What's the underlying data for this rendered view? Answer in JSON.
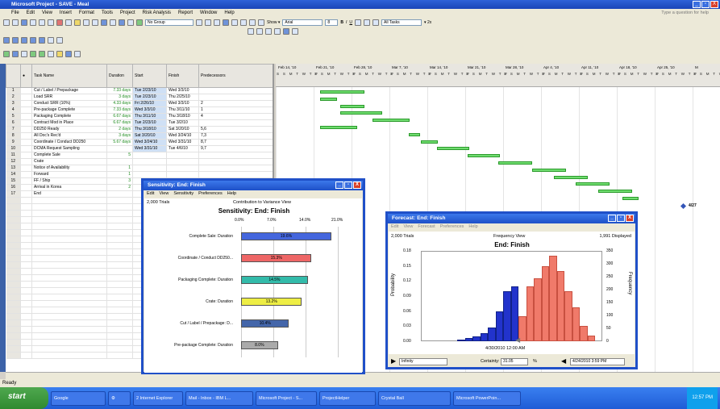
{
  "app": {
    "title": "Microsoft Project - SAVE - Meal",
    "minimize": "_",
    "restore": "▫",
    "close": "X"
  },
  "menu": {
    "items": [
      "File",
      "Edit",
      "View",
      "Insert",
      "Format",
      "Tools",
      "Project",
      "Risk Analysis",
      "Report",
      "Window",
      "Help"
    ],
    "ask": "Type a question for help"
  },
  "toolbar": {
    "group": "No Group",
    "show": "Show ▾",
    "font": "Arial",
    "size": "8",
    "bold": "B",
    "italic": "I",
    "underline": "U",
    "filter": "All Tasks",
    "zoom": "▾ 2x"
  },
  "grid": {
    "headers": {
      "id": "",
      "indicator": "Indicators",
      "name": "Task Name",
      "duration": "Duration",
      "start": "Start",
      "finish": "Finish",
      "pred": "Predecessors"
    },
    "rows": [
      {
        "id": "1",
        "name": "Cut / Label / Prepackage",
        "duration": "7.33 days",
        "start": "Tue 2/23/10",
        "finish": "Wed 3/3/10",
        "pred": ""
      },
      {
        "id": "2",
        "name": "Load SRR",
        "duration": "3 days",
        "start": "Tue 2/23/10",
        "finish": "Thu 2/25/10",
        "pred": ""
      },
      {
        "id": "3",
        "name": "Conduct SRR (10%)",
        "duration": "4.33 days",
        "start": "Fri 2/26/10",
        "finish": "Wed 3/3/10",
        "pred": "2"
      },
      {
        "id": "4",
        "name": "Pre-package Complete",
        "duration": "7.33 days",
        "start": "Wed 3/3/10",
        "finish": "Thu 3/11/10",
        "pred": "1"
      },
      {
        "id": "5",
        "name": "Packaging Complete",
        "duration": "6.67 days",
        "start": "Thu 3/11/10",
        "finish": "Thu 3/18/10",
        "pred": "4"
      },
      {
        "id": "6",
        "name": "Contract Mod in Place",
        "duration": "6.67 days",
        "start": "Tue 2/23/10",
        "finish": "Tue 3/2/10",
        "pred": ""
      },
      {
        "id": "7",
        "name": "DD250 Ready",
        "duration": "2 days",
        "start": "Thu 3/18/10",
        "finish": "Sat 3/20/10",
        "pred": "5,6"
      },
      {
        "id": "8",
        "name": "All Doc's Rec'd",
        "duration": "3 days",
        "start": "Sat 3/20/10",
        "finish": "Wed 3/24/10",
        "pred": "7,3"
      },
      {
        "id": "9",
        "name": "Coordinate / Conduct DD250",
        "duration": "5.67 days",
        "start": "Wed 3/24/10",
        "finish": "Wed 3/31/10",
        "pred": "8,7"
      },
      {
        "id": "10",
        "name": "DCMA Request Sampling",
        "duration": "",
        "start": "Wed 3/31/10",
        "finish": "Tue 4/6/10",
        "pred": "9,7"
      },
      {
        "id": "11",
        "name": "Complete Sale",
        "duration": "5",
        "start": "",
        "finish": "",
        "pred": ""
      },
      {
        "id": "12",
        "name": "Crate",
        "duration": "",
        "start": "",
        "finish": "",
        "pred": ""
      },
      {
        "id": "13",
        "name": "Notice of Availability",
        "duration": "1",
        "start": "",
        "finish": "",
        "pred": ""
      },
      {
        "id": "14",
        "name": "Forward",
        "duration": "1",
        "start": "",
        "finish": "",
        "pred": ""
      },
      {
        "id": "15",
        "name": "FF / Ship",
        "duration": "3",
        "start": "",
        "finish": "",
        "pred": ""
      },
      {
        "id": "16",
        "name": "Arrival in Korea",
        "duration": "2",
        "start": "",
        "finish": "",
        "pred": ""
      },
      {
        "id": "17",
        "name": "End",
        "duration": "",
        "start": "",
        "finish": "",
        "pred": ""
      }
    ]
  },
  "gantt": {
    "weeks": [
      "Feb 14, '10",
      "Feb 21, '10",
      "Feb 28, '10",
      "Mar 7, '10",
      "Mar 14, '10",
      "Mar 21, '10",
      "Mar 28, '10",
      "Apr 4, '10",
      "Apr 11, '10",
      "Apr 18, '10",
      "Apr 25, '10",
      "M"
    ],
    "days": "S S M T W T F",
    "milestone_label": "4/27"
  },
  "sensitivity": {
    "title": "Sensitivity: End: Finish",
    "menu": [
      "Edit",
      "View",
      "Sensitivity",
      "Preferences",
      "Help"
    ],
    "trials": "2,000 Trials",
    "view": "Contribution to Variance View",
    "heading": "Sensitivity: End: Finish",
    "ticks": [
      "0.0%",
      "7.0%",
      "14.0%",
      "21.0%"
    ]
  },
  "forecast": {
    "title": "Forecast: End: Finish",
    "menu": [
      "Edit",
      "View",
      "Forecast",
      "Preferences",
      "Help"
    ],
    "trials": "2,000 Trials",
    "view": "Frequency View",
    "displayed": "1,991 Displayed",
    "heading": "End: Finish",
    "ylabel_left": "Probability",
    "ylabel_right": "Frequency",
    "xlabel": "4/30/2010 12:00 AM",
    "left_value": "Infinity",
    "certainty_label": "Certainty:",
    "certainty": "31.05",
    "pct": "%",
    "right_value": "4/24/2010 3:59 PM"
  },
  "chart_data": [
    {
      "type": "bar",
      "title": "Sensitivity: End: Finish",
      "xlabel": "",
      "ylabel": "",
      "xlim": [
        0,
        21
      ],
      "categories": [
        "Complete Sale: Duration",
        "Coordinate / Conduct DD250...",
        "Packaging Complete: Duration",
        "Crate: Duration",
        "Cut / Label / Prepackage: D...",
        "Pre-package Complete: Duration"
      ],
      "values": [
        19.6,
        15.3,
        14.5,
        13.2,
        10.4,
        8.0
      ],
      "labels": [
        "19.6%",
        "15.3%",
        "14.5%",
        "13.2%",
        "10.4%",
        "8.0%"
      ],
      "colors": [
        "#4466dd",
        "#ee6666",
        "#33bbaa",
        "#eeee44",
        "#4466aa",
        "#aaaaaa"
      ]
    },
    {
      "type": "bar",
      "title": "End: Finish",
      "xlabel": "4/30/2010 12:00 AM",
      "ylabel": "Probability",
      "ylim": [
        0,
        0.18
      ],
      "y_ticks": [
        "0.18",
        "0.15",
        "0.12",
        "0.09",
        "0.06",
        "0.03",
        "0.00"
      ],
      "freq_ticks": [
        "350",
        "300",
        "250",
        "200",
        "150",
        "100",
        "50",
        "0"
      ],
      "values": [
        0.003,
        0.006,
        0.01,
        0.016,
        0.028,
        0.06,
        0.1,
        0.11,
        0.05,
        0.11,
        0.125,
        0.15,
        0.17,
        0.14,
        0.1,
        0.068,
        0.03,
        0.012
      ],
      "split_index": 8
    }
  ]
}
